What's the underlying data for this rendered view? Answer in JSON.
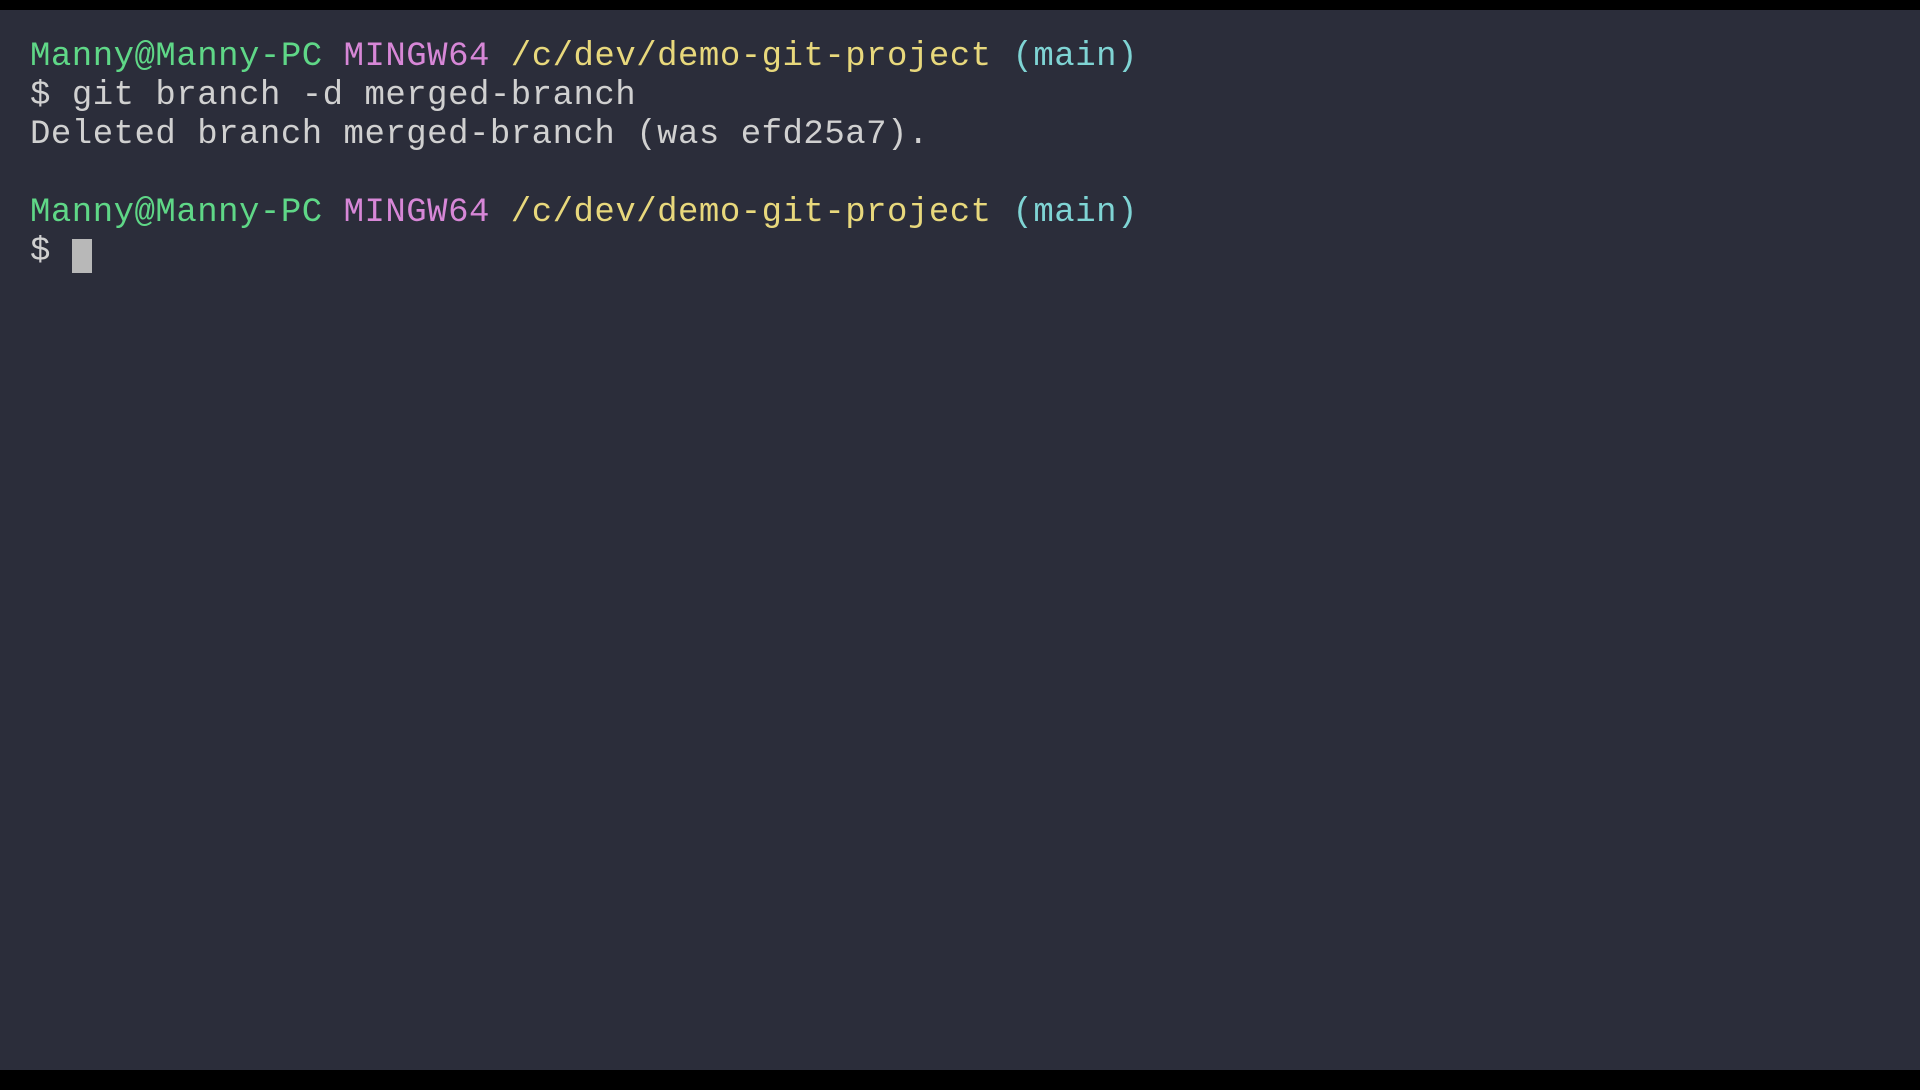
{
  "terminal": {
    "blocks": [
      {
        "prompt": {
          "user_host": "Manny@Manny-PC",
          "env": "MINGW64",
          "path": "/c/dev/demo-git-project",
          "branch": "(main)"
        },
        "command_line": {
          "symbol": "$",
          "command": "git branch -d merged-branch"
        },
        "output": "Deleted branch merged-branch (was efd25a7)."
      },
      {
        "prompt": {
          "user_host": "Manny@Manny-PC",
          "env": "MINGW64",
          "path": "/c/dev/demo-git-project",
          "branch": "(main)"
        },
        "command_line": {
          "symbol": "$",
          "command": ""
        }
      }
    ]
  }
}
